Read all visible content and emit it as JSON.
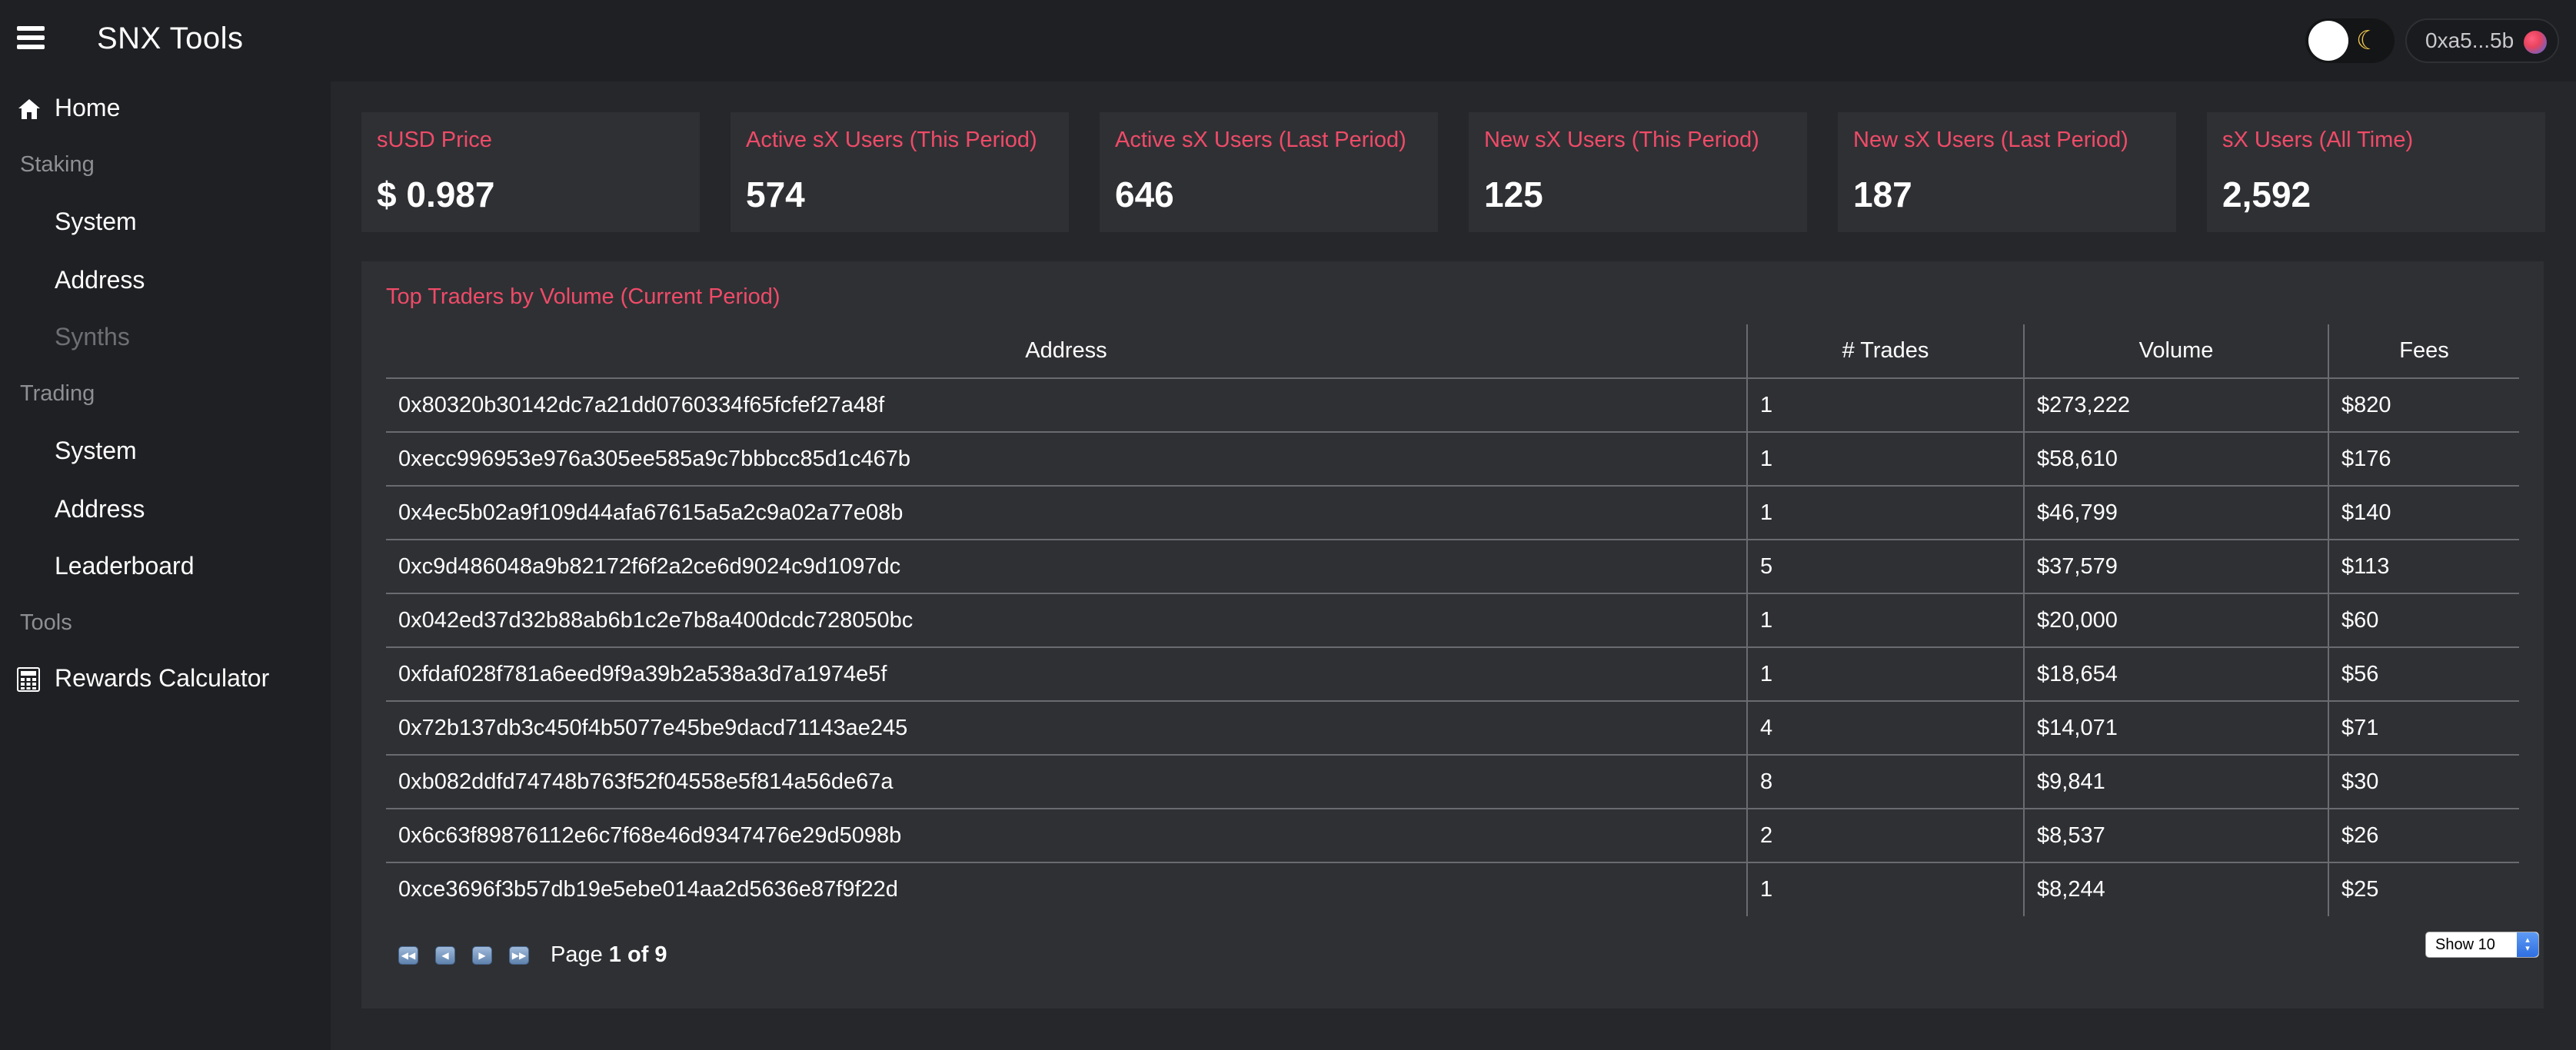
{
  "header": {
    "brand": "SNX Tools",
    "wallet_address": "0xa5...5b"
  },
  "sidebar": {
    "home": "Home",
    "staking_section": "Staking",
    "staking_system": "System",
    "staking_address": "Address",
    "staking_synths": "Synths",
    "trading_section": "Trading",
    "trading_system": "System",
    "trading_address": "Address",
    "trading_leaderboard": "Leaderboard",
    "tools_section": "Tools",
    "rewards_calculator": "Rewards Calculator"
  },
  "stats": [
    {
      "label": "sUSD Price",
      "value": "$ 0.987"
    },
    {
      "label": "Active sX Users (This Period)",
      "value": "574"
    },
    {
      "label": "Active sX Users (Last Period)",
      "value": "646"
    },
    {
      "label": "New sX Users (This Period)",
      "value": "125"
    },
    {
      "label": "New sX Users (Last Period)",
      "value": "187"
    },
    {
      "label": "sX Users (All Time)",
      "value": "2,592"
    }
  ],
  "traders": {
    "title": "Top Traders by Volume (Current Period)",
    "columns": [
      "Address",
      "# Trades",
      "Volume",
      "Fees"
    ],
    "rows": [
      [
        "0x80320b30142dc7a21dd0760334f65fcfef27a48f",
        "1",
        "$273,222",
        "$820"
      ],
      [
        "0xecc996953e976a305ee585a9c7bbbcc85d1c467b",
        "1",
        "$58,610",
        "$176"
      ],
      [
        "0x4ec5b02a9f109d44afa67615a5a2c9a02a77e08b",
        "1",
        "$46,799",
        "$140"
      ],
      [
        "0xc9d486048a9b82172f6f2a2ce6d9024c9d1097dc",
        "5",
        "$37,579",
        "$113"
      ],
      [
        "0x042ed37d32b88ab6b1c2e7b8a400dcdc728050bc",
        "1",
        "$20,000",
        "$60"
      ],
      [
        "0xfdaf028f781a6eed9f9a39b2a538a3d7a1974e5f",
        "1",
        "$18,654",
        "$56"
      ],
      [
        "0x72b137db3c450f4b5077e45be9dacd71143ae245",
        "4",
        "$14,071",
        "$71"
      ],
      [
        "0xb082ddfd74748b763f52f04558e5f814a56de67a",
        "8",
        "$9,841",
        "$30"
      ],
      [
        "0x6c63f89876112e6c7f68e46d9347476e29d5098b",
        "2",
        "$8,537",
        "$26"
      ],
      [
        "0xce3696f3b57db19e5ebe014aa2d5636e87f9f22d",
        "1",
        "$8,244",
        "$25"
      ]
    ],
    "page_label": "Page",
    "page_current": "1 of 9",
    "page_size_label": "Show 10"
  },
  "colors": {
    "accent": "#ef4b68",
    "background": "#26272b",
    "sidebar": "#1f2023",
    "card": "#2f3034"
  }
}
